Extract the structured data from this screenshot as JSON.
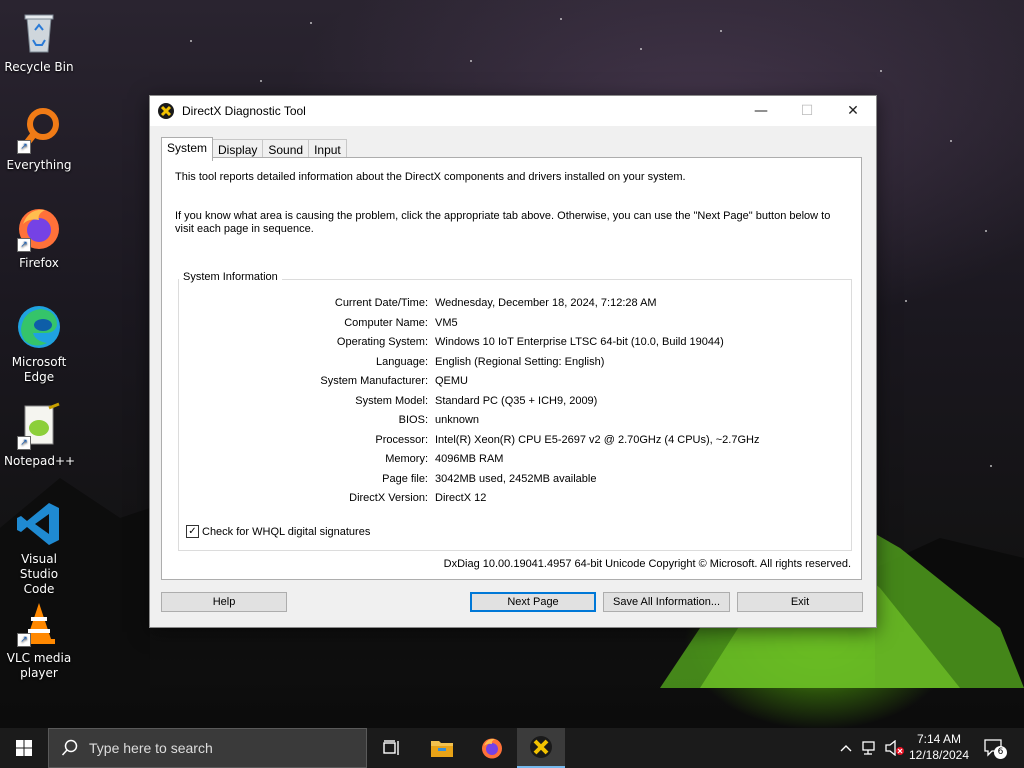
{
  "desktop": {
    "icons": [
      {
        "label": "Recycle Bin"
      },
      {
        "label": "Everything"
      },
      {
        "label": "Firefox"
      },
      {
        "label": "Microsoft Edge"
      },
      {
        "label": "Notepad++"
      },
      {
        "label": "Visual Studio Code"
      },
      {
        "label": "VLC media player"
      }
    ]
  },
  "window": {
    "title": "DirectX Diagnostic Tool",
    "controls": {
      "minimize": "—",
      "maximize": "☐",
      "close": "✕"
    },
    "tabs": [
      {
        "label": "System",
        "active": true
      },
      {
        "label": "Display",
        "active": false
      },
      {
        "label": "Sound",
        "active": false
      },
      {
        "label": "Input",
        "active": false
      }
    ],
    "intro_line1": "This tool reports detailed information about the DirectX components and drivers installed on your system.",
    "intro_line2": "If you know what area is causing the problem, click the appropriate tab above.  Otherwise, you can use the \"Next Page\" button below to visit each page in sequence.",
    "group_title": "System Information",
    "info": [
      {
        "label": "Current Date/Time:",
        "value": "Wednesday, December 18, 2024, 7:12:28 AM"
      },
      {
        "label": "Computer Name:",
        "value": "VM5"
      },
      {
        "label": "Operating System:",
        "value": "Windows 10 IoT Enterprise LTSC 64-bit (10.0, Build 19044)"
      },
      {
        "label": "Language:",
        "value": "English (Regional Setting: English)"
      },
      {
        "label": "System Manufacturer:",
        "value": "QEMU"
      },
      {
        "label": "System Model:",
        "value": "Standard PC (Q35 + ICH9, 2009)"
      },
      {
        "label": "BIOS:",
        "value": "unknown"
      },
      {
        "label": "Processor:",
        "value": "Intel(R) Xeon(R) CPU E5-2697 v2 @ 2.70GHz (4 CPUs), ~2.7GHz"
      },
      {
        "label": "Memory:",
        "value": "4096MB RAM"
      },
      {
        "label": "Page file:",
        "value": "3042MB used, 2452MB available"
      },
      {
        "label": "DirectX Version:",
        "value": "DirectX 12"
      }
    ],
    "whql": {
      "label": "Check for WHQL digital signatures",
      "checked": true,
      "check_glyph": "✓"
    },
    "footer": "DxDiag 10.00.19041.4957 64-bit Unicode  Copyright © Microsoft. All rights reserved.",
    "buttons": {
      "help": "Help",
      "next_page": "Next Page",
      "save_all": "Save All Information...",
      "exit": "Exit"
    }
  },
  "taskbar": {
    "search_placeholder": "Type here to search",
    "clock_time": "7:14 AM",
    "clock_date": "12/18/2024",
    "notification_count": "6",
    "accent_color": "#76b9ed"
  }
}
